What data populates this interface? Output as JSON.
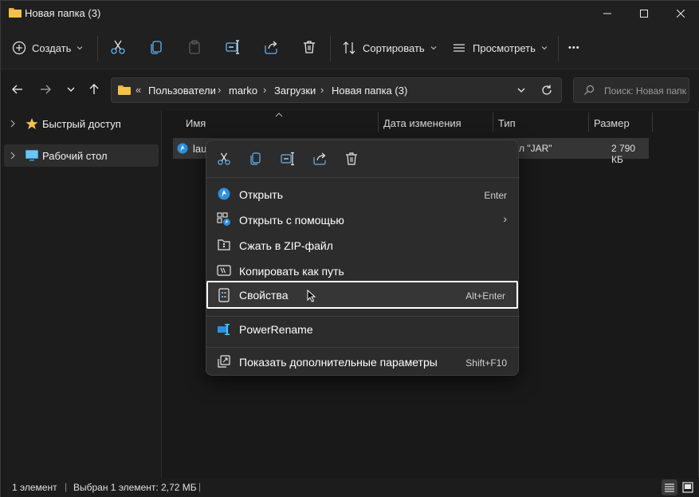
{
  "window": {
    "title": "Новая папка (3)"
  },
  "toolbar": {
    "create_label": "Создать",
    "sort_label": "Сортировать",
    "view_label": "Просмотреть",
    "more_label": "•••"
  },
  "address": {
    "overflow": "«",
    "crumbs": [
      "Пользователи",
      "marko",
      "Загрузки",
      "Новая папка (3)"
    ],
    "separator": "›"
  },
  "search": {
    "placeholder": "Поиск: Новая папка"
  },
  "sidebar": {
    "items": [
      {
        "label": "Быстрый доступ",
        "icon": "star-icon"
      },
      {
        "label": "Рабочий стол",
        "icon": "desktop-icon"
      }
    ]
  },
  "columns": {
    "name": "Имя",
    "date": "Дата изменения",
    "type": "Тип",
    "size": "Размер"
  },
  "file": {
    "name": "lau",
    "type": "л \"JAR\"",
    "size": "2 790 КБ"
  },
  "context_menu": {
    "items": [
      {
        "label": "Открыть",
        "shortcut": "Enter",
        "icon": "launcher-icon"
      },
      {
        "label": "Открыть с помощью",
        "shortcut": "›",
        "icon": "open-with-icon"
      },
      {
        "label": "Сжать в ZIP-файл",
        "shortcut": "",
        "icon": "zip-icon"
      },
      {
        "label": "Копировать как путь",
        "shortcut": "",
        "icon": "copy-path-icon"
      },
      {
        "label": "Свойства",
        "shortcut": "Alt+Enter",
        "icon": "properties-icon"
      },
      {
        "label": "PowerRename",
        "shortcut": "",
        "icon": "powerrename-icon"
      },
      {
        "label": "Показать дополнительные параметры",
        "shortcut": "Shift+F10",
        "icon": "more-options-icon"
      }
    ]
  },
  "status": {
    "count": "1 элемент",
    "selected": "Выбран 1 элемент: 2,72 МБ"
  },
  "colors": {
    "accent": "#4cc2ff",
    "folder": "#f5c249",
    "background": "#191919"
  }
}
